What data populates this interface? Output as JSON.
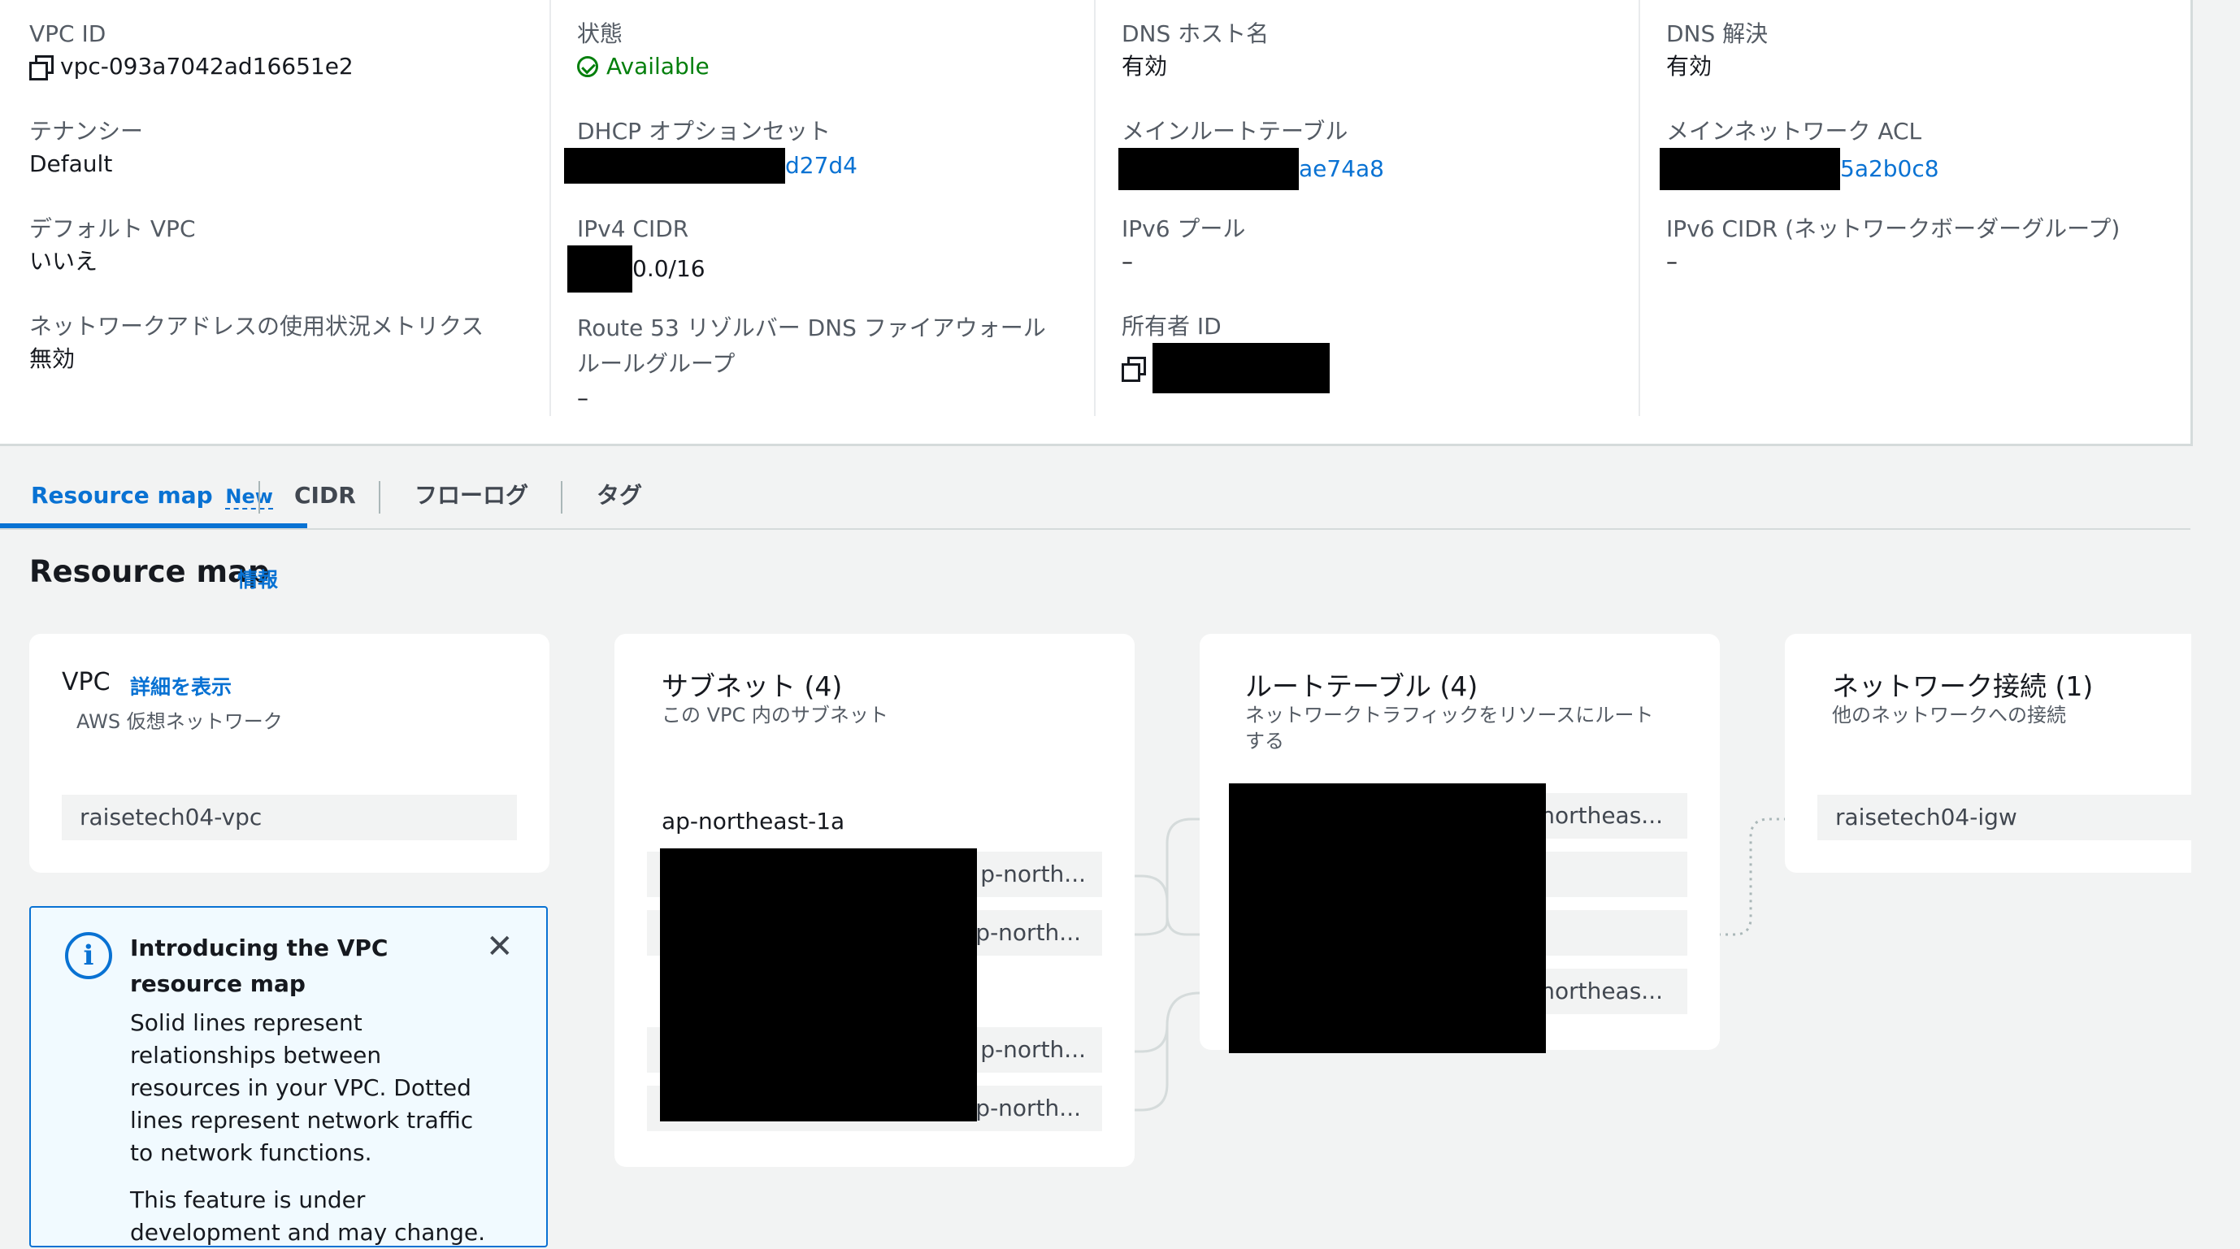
{
  "details": {
    "col1": [
      {
        "label": "VPC ID",
        "value": "vpc-093a7042ad16651e2"
      },
      {
        "label": "テナンシー",
        "value": "Default"
      },
      {
        "label": "デフォルト VPC",
        "value": "いいえ"
      },
      {
        "label": "ネットワークアドレスの使用状況メトリクス",
        "value": "無効"
      }
    ],
    "col2": [
      {
        "label": "状態",
        "value": "Available"
      },
      {
        "label": "DHCP オプションセット",
        "value": "d27d4"
      },
      {
        "label": "IPv4 CIDR",
        "value": "0.0/16"
      },
      {
        "label": "Route 53 リゾルバー DNS ファイアウォールルールグループ",
        "value": "–"
      }
    ],
    "col3": [
      {
        "label": "DNS ホスト名",
        "value": "有効"
      },
      {
        "label": "メインルートテーブル",
        "value": "ae74a8"
      },
      {
        "label": "IPv6 プール",
        "value": "–"
      },
      {
        "label": "所有者 ID",
        "value": ""
      }
    ],
    "col4": [
      {
        "label": "DNS 解決",
        "value": "有効"
      },
      {
        "label": "メインネットワーク ACL",
        "value": "5a2b0c8"
      },
      {
        "label": "IPv6 CIDR (ネットワークボーダーグループ)",
        "value": "–"
      }
    ]
  },
  "tabs": [
    {
      "label": "Resource map",
      "badge": "New"
    },
    {
      "label": "CIDR"
    },
    {
      "label": "フローログ"
    },
    {
      "label": "タグ"
    }
  ],
  "resource_map": {
    "title": "Resource map",
    "info": "情報",
    "vpc": {
      "title": "VPC",
      "details_link": "詳細を表示",
      "subtitle": "AWS 仮想ネットワーク",
      "item": "raisetech04-vpc"
    },
    "subnets": {
      "title": "サブネット (4)",
      "subtitle": "この VPC 内のサブネット",
      "az": "ap-northeast-1a",
      "items": [
        "p-north...",
        "p-north...",
        "p-north...",
        "p-north..."
      ]
    },
    "route_tables": {
      "title": "ルートテーブル (4)",
      "subtitle": "ネットワークトラフィックをリソースにルートする",
      "items": [
        "northeas...",
        "",
        "",
        "northeas..."
      ]
    },
    "network": {
      "title": "ネットワーク接続 (1)",
      "subtitle": "他のネットワークへの接続",
      "item": "raisetech04-igw"
    }
  },
  "notice": {
    "title": "Introducing the VPC resource map",
    "body": "Solid lines represent relationships between resources in your VPC. Dotted lines represent network traffic to network functions.",
    "body2": "This feature is under development and may change."
  }
}
